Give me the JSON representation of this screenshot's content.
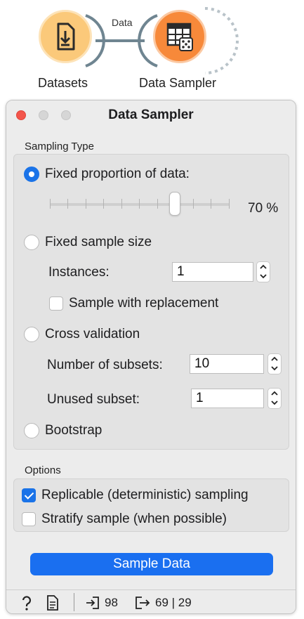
{
  "workflow": {
    "link_label": "Data",
    "nodes": [
      {
        "label": "Datasets",
        "icon": "file-import-icon",
        "color": "#fbc97a"
      },
      {
        "label": "Data Sampler",
        "icon": "table-dice-icon",
        "color": "#f7893a"
      }
    ]
  },
  "window": {
    "title": "Data Sampler",
    "traffic_lights": {
      "close": "#f3554b",
      "minimize": "#d6d6d6",
      "zoom": "#d6d6d6"
    }
  },
  "sampling": {
    "group_label": "Sampling Type",
    "fixed_proportion": {
      "label": "Fixed proportion of data:",
      "selected": true,
      "value_text": "70 %",
      "value": 70
    },
    "fixed_size": {
      "label": "Fixed sample size",
      "selected": false,
      "instances_label": "Instances:",
      "instances_value": "1",
      "replacement_label": "Sample with replacement",
      "replacement_checked": false
    },
    "cross_validation": {
      "label": "Cross validation",
      "selected": false,
      "subsets_label": "Number of subsets:",
      "subsets_value": "10",
      "unused_label": "Unused subset:",
      "unused_value": "1"
    },
    "bootstrap": {
      "label": "Bootstrap",
      "selected": false
    }
  },
  "options": {
    "group_label": "Options",
    "replicable": {
      "label": "Replicable (deterministic) sampling",
      "checked": true
    },
    "stratify": {
      "label": "Stratify sample (when possible)",
      "checked": false
    }
  },
  "action": {
    "label": "Sample Data",
    "color": "#1a6ff0"
  },
  "status": {
    "input_count": "98",
    "output_text": "69 | 29"
  }
}
